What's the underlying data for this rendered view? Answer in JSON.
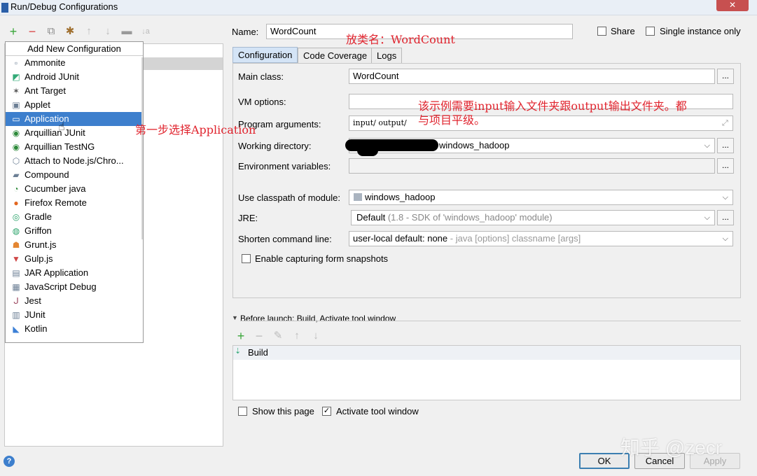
{
  "window": {
    "title": "Run/Debug Configurations"
  },
  "toolbar": {
    "icons": [
      "add-icon",
      "remove-icon",
      "copy-icon",
      "wrench-icon",
      "move-up-icon",
      "move-down-icon",
      "folder-icon",
      "sort-icon"
    ]
  },
  "popup": {
    "header": "Add New Configuration",
    "items": [
      {
        "label": "Ammonite",
        "icon": "ammonite-icon"
      },
      {
        "label": "Android JUnit",
        "icon": "android-junit-icon"
      },
      {
        "label": "Ant Target",
        "icon": "ant-target-icon"
      },
      {
        "label": "Applet",
        "icon": "applet-icon"
      },
      {
        "label": "Application",
        "icon": "application-icon",
        "selected": true
      },
      {
        "label": "Arquillian JUnit",
        "icon": "arquillian-icon"
      },
      {
        "label": "Arquillian TestNG",
        "icon": "arquillian-icon"
      },
      {
        "label": "Attach to Node.js/Chro...",
        "icon": "nodejs-icon"
      },
      {
        "label": "Compound",
        "icon": "compound-icon"
      },
      {
        "label": "Cucumber java",
        "icon": "cucumber-icon"
      },
      {
        "label": "Firefox Remote",
        "icon": "firefox-icon"
      },
      {
        "label": "Gradle",
        "icon": "gradle-icon"
      },
      {
        "label": "Griffon",
        "icon": "griffon-icon"
      },
      {
        "label": "Grunt.js",
        "icon": "grunt-icon"
      },
      {
        "label": "Gulp.js",
        "icon": "gulp-icon"
      },
      {
        "label": "JAR Application",
        "icon": "jar-icon"
      },
      {
        "label": "JavaScript Debug",
        "icon": "js-debug-icon"
      },
      {
        "label": "Jest",
        "icon": "jest-icon"
      },
      {
        "label": "JUnit",
        "icon": "junit-icon"
      },
      {
        "label": "Kotlin",
        "icon": "kotlin-icon"
      }
    ]
  },
  "name": {
    "label": "Name:",
    "value": "WordCount"
  },
  "share": {
    "label": "Share",
    "checked": false
  },
  "single_instance": {
    "label": "Single instance only",
    "checked": false
  },
  "tabs": [
    {
      "label": "Configuration",
      "active": true
    },
    {
      "label": "Code Coverage",
      "active": false
    },
    {
      "label": "Logs",
      "active": false
    }
  ],
  "form": {
    "main_class": {
      "label": "Main class:",
      "value": "WordCount"
    },
    "vm_options": {
      "label": "VM options:",
      "value": ""
    },
    "program_args": {
      "label": "Program arguments:",
      "value": "input/ output/"
    },
    "working_dir": {
      "label": "Working directory:",
      "value": "windows_hadoop"
    },
    "env_vars": {
      "label": "Environment variables:",
      "value": ""
    },
    "classpath": {
      "label": "Use classpath of module:",
      "value": "windows_hadoop"
    },
    "jre": {
      "label": "JRE:",
      "value": "Default",
      "hint": "(1.8 - SDK of 'windows_hadoop' module)"
    },
    "shorten": {
      "label": "Shorten command line:",
      "value": "user-local default: none",
      "hint": " - java [options] classname [args]"
    },
    "snapshots": {
      "label": "Enable capturing form snapshots",
      "checked": false
    }
  },
  "before_launch": {
    "header": "Before launch: Build, Activate tool window",
    "items": [
      "Build"
    ]
  },
  "show_page": {
    "label": "Show this page",
    "checked": false
  },
  "activate_tool": {
    "label": "Activate tool window",
    "checked": true
  },
  "buttons": {
    "ok": "OK",
    "cancel": "Cancel",
    "apply": "Apply"
  },
  "annotations": {
    "name_note": "放类名：WordCount",
    "step_note": "第一步选择Application",
    "io_note_1": "该示例需要input输入文件夹跟output输出文件夹。都",
    "io_note_2": "与项目平级。"
  },
  "watermark": "知乎 @zecr",
  "help_icon": "?"
}
